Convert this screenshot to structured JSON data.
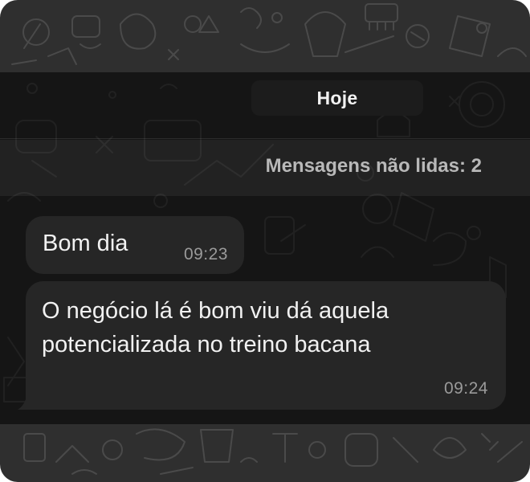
{
  "chat": {
    "date_label": "Hoje",
    "unread_label": "Mensagens não lidas: 2",
    "messages": [
      {
        "text": "Bom dia",
        "time": "09:23"
      },
      {
        "text": "O negócio lá é bom viu dá aquela potencializada no treino bacana",
        "time": "09:24"
      }
    ]
  },
  "colors": {
    "wallpaper": "#2f2f2f",
    "bubble": "#262626",
    "date_pill": "#1c1c1c",
    "text": "#f1f1f1",
    "timestamp": "#9a9a9a"
  }
}
